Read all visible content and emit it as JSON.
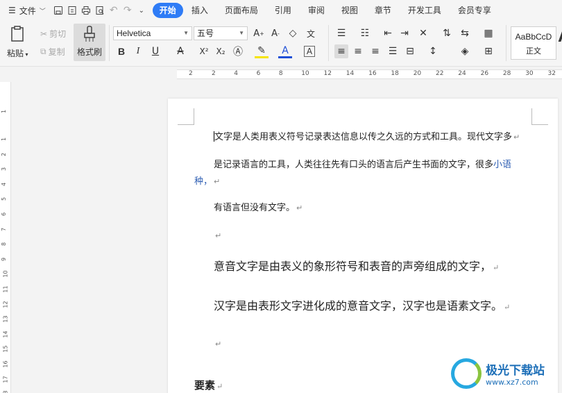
{
  "menubar": {
    "file_label": "文件",
    "tabs": [
      {
        "label": "开始",
        "active": true
      },
      {
        "label": "插入"
      },
      {
        "label": "页面布局"
      },
      {
        "label": "引用"
      },
      {
        "label": "审阅"
      },
      {
        "label": "视图"
      },
      {
        "label": "章节"
      },
      {
        "label": "开发工具"
      },
      {
        "label": "会员专享"
      }
    ]
  },
  "ribbon": {
    "paste_label": "粘贴",
    "cut_label": "剪切",
    "copy_label": "复制",
    "format_painter_label": "格式刷",
    "font_name": "Helvetica",
    "font_size": "五号",
    "style_preview": "AaBbCcD",
    "style_name": "正文"
  },
  "ruler": {
    "ticks": [
      "2",
      "2",
      "4",
      "6",
      "8",
      "10",
      "12",
      "14",
      "16",
      "18",
      "20",
      "22",
      "24",
      "26",
      "28",
      "30",
      "32"
    ],
    "v_ticks": [
      "1",
      "1",
      "2",
      "3",
      "4",
      "5",
      "6",
      "7",
      "8",
      "9",
      "10",
      "11",
      "12",
      "13",
      "14",
      "15",
      "16",
      "17",
      "18"
    ]
  },
  "document": {
    "p1": "文字是人类用表义符号记录表达信息以传之久远的方式和工具。现代文字多",
    "p2a": "是记录语言的工具，人类往往先有口头的语言后产生书面的文字，很多",
    "p2b": "小语",
    "p2c": "种，",
    "p3": "有语言但没有文字。",
    "p5": "意音文字是由表义的象形符号和表音的声旁组成的文字，",
    "p6": "汉字是由表形文字进化成的意音文字，汉字也是语素文字。",
    "heading": "要素",
    "mark": "↵"
  },
  "watermark": {
    "title": "极光下载站",
    "url": "www.xz7.com"
  }
}
